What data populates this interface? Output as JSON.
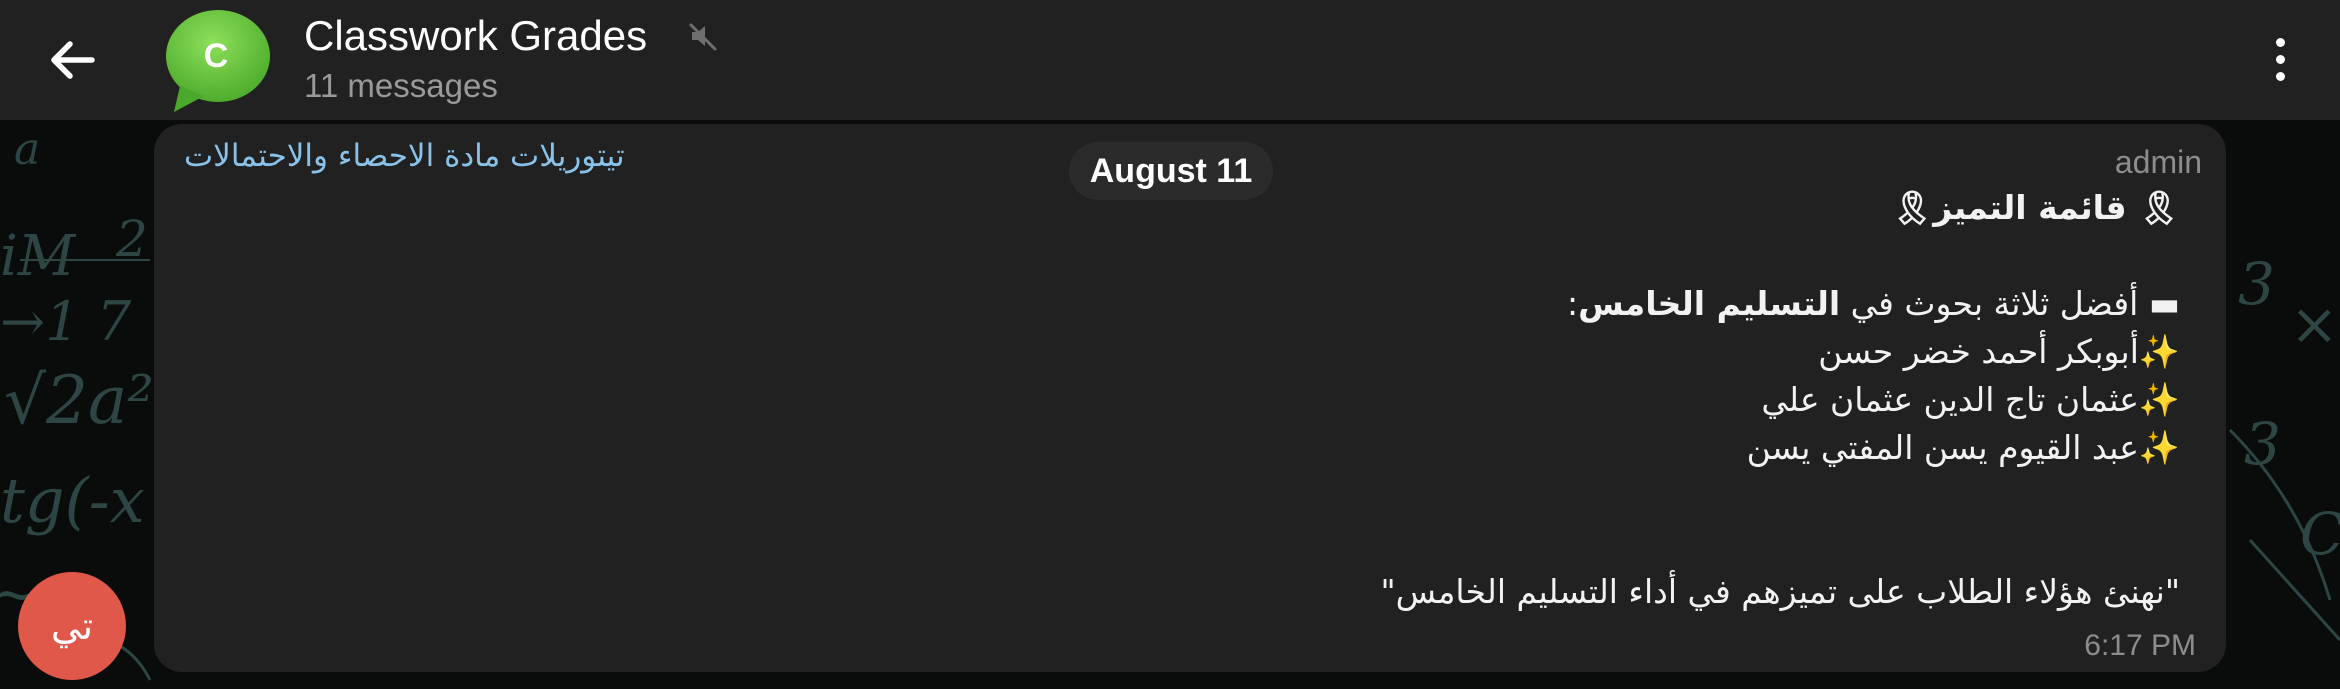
{
  "header": {
    "title": "Classwork Grades",
    "subtitle": "11 messages",
    "avatar_letter": "C",
    "avatar_color": "#6cc43a"
  },
  "date_separator": "August 11",
  "message": {
    "channel_link": "تيتوريلات مادة الاحصاء والاحتمالات",
    "author": "admin",
    "heading_prefix": "🎗",
    "heading_text": " قائمة التميز",
    "heading_suffix": "🎗",
    "intro_marker": "▬ ",
    "intro_text": "أفضل ثلاثة بحوث في ",
    "intro_bold": "التسليم الخامس",
    "intro_colon": ":",
    "students": [
      "✨أبوبكر أحمد خضر حسن",
      "✨عثمان تاج الدين عثمان علي",
      "✨عبد القيوم يسن المفتي يسن"
    ],
    "footer_quote": "\"نهنئ هؤلاء الطلاب على تميزهم في أداء التسليم الخامس\"",
    "time": "6:17 PM"
  },
  "fab": {
    "label": "تي",
    "color": "#e0584a"
  },
  "colors": {
    "header_bg": "#212121",
    "bubble_bg": "#212121",
    "link": "#8ac2ea",
    "muted_text": "#8d8d8d"
  }
}
